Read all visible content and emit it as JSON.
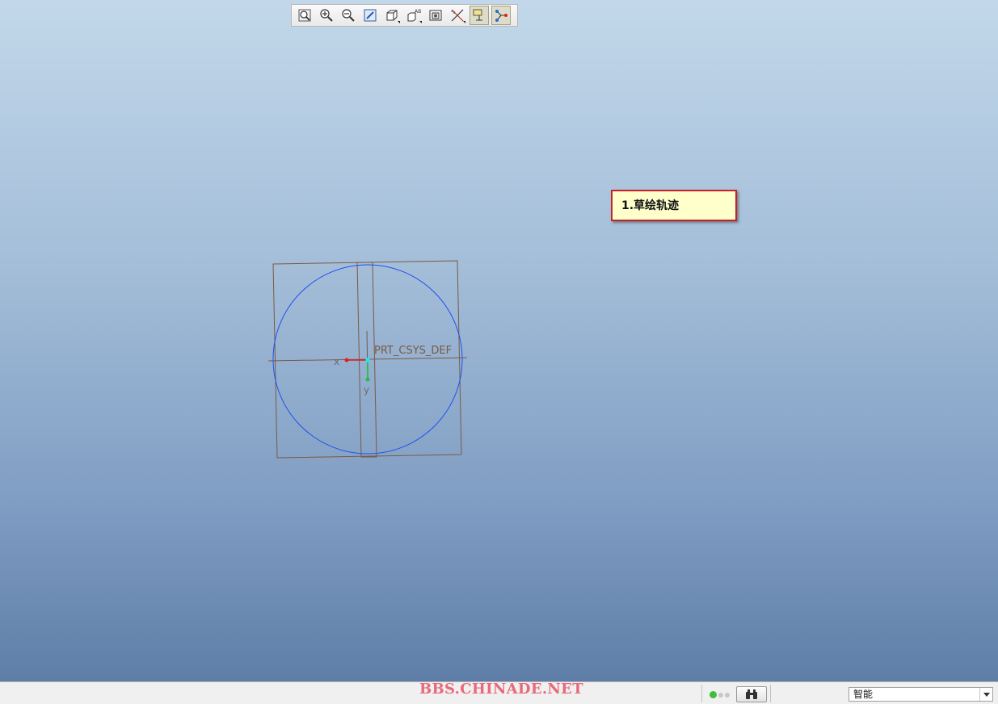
{
  "toolbar": {
    "items": [
      {
        "name": "refit",
        "icon": "refit-icon"
      },
      {
        "name": "zoom-in",
        "icon": "zoom-in-icon"
      },
      {
        "name": "zoom-out",
        "icon": "zoom-out-icon"
      },
      {
        "name": "repaint",
        "icon": "repaint-icon"
      },
      {
        "name": "display-style",
        "icon": "cube-icon"
      },
      {
        "name": "saved-views",
        "icon": "saved-views-icon"
      },
      {
        "name": "sketch-view",
        "icon": "sketch-view-icon"
      },
      {
        "name": "datum-display",
        "icon": "datum-display-icon"
      },
      {
        "name": "sketch-display",
        "icon": "sketch-display-icon"
      },
      {
        "name": "vertex-display",
        "icon": "vertex-display-icon"
      }
    ]
  },
  "callout": {
    "text": "1.草绘轨迹"
  },
  "sketch": {
    "csys_label": "PRT_CSYS_DEF",
    "axis_x_label": "x",
    "axis_y_label": "y",
    "colors": {
      "datum": "#7a5a44",
      "circle": "#2050f0",
      "x_axis": "#e02020",
      "y_axis": "#20c040",
      "origin": "#30e0e8"
    }
  },
  "statusbar": {
    "watermark": "BBS.CHINADE.NET",
    "filter_value": "智能"
  },
  "colors": {
    "callout_border": "#c8202a",
    "callout_bg": "#ffffcc",
    "watermark": "#e86a7a"
  }
}
